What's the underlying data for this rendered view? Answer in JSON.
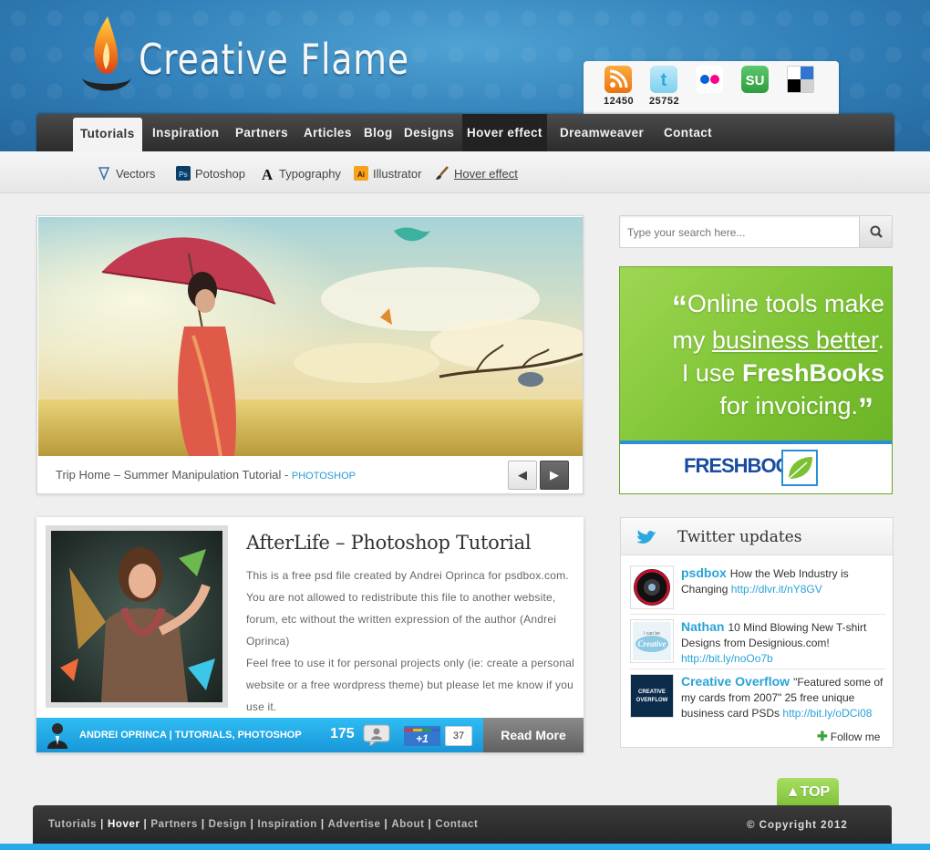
{
  "site": {
    "title": "Creative Flame"
  },
  "social": {
    "rss_count": "12450",
    "twitter_count": "25752"
  },
  "nav": {
    "items": [
      {
        "label": "Tutorials",
        "state": "active"
      },
      {
        "label": "Inspiration",
        "state": ""
      },
      {
        "label": "Partners",
        "state": ""
      },
      {
        "label": "Articles",
        "state": ""
      },
      {
        "label": "Blog",
        "state": ""
      },
      {
        "label": "Designs",
        "state": ""
      },
      {
        "label": "Hover effect",
        "state": "hover"
      },
      {
        "label": "Dreamweaver",
        "state": ""
      },
      {
        "label": "Contact",
        "state": ""
      }
    ]
  },
  "subnav": {
    "items": [
      {
        "label": "Vectors"
      },
      {
        "label": "Potoshop"
      },
      {
        "label": "Typography"
      },
      {
        "label": "Illustrator"
      },
      {
        "label": "Hover effect"
      }
    ]
  },
  "slider": {
    "caption": "Trip Home – Summer  Manipulation Tutorial - ",
    "category": "PHOTOSHOP",
    "prev": "◀",
    "next": "▶"
  },
  "post": {
    "title": "AfterLife – Photoshop Tutorial",
    "paragraph1": "This is a free psd file created by Andrei Oprinca for psdbox.com. You are not allowed to redistribute this file to another website, forum, etc without the written expression of the author (Andrei Oprinca)",
    "paragraph2": "Feel free to use it for personal projects only (ie: create a personal website or a free wordpress theme) but please let me know if you use it.",
    "meta": "ANDREI OPRINCA | TUTORIALS, PHOTOSHOP",
    "comments": "175",
    "plus_one": "+1",
    "plus_one_count": "37",
    "read_more": "Read More"
  },
  "search": {
    "placeholder": "Type your search here..."
  },
  "ad": {
    "line1": "Online tools make",
    "line2_pre": "my ",
    "line2_u": "business better",
    "line2_post": ".",
    "line3_pre": "I use ",
    "line3_b": "FreshBooks",
    "line4": "for invoicing.",
    "logo": "FRESHBOOKS"
  },
  "twitter": {
    "title": "Twitter updates",
    "tweets": [
      {
        "name": "psdbox",
        "text": "How the Web Industry is Changing ",
        "link": "http://dlvr.it/nY8GV"
      },
      {
        "name": "Nathan",
        "text": "10 Mind Blowing New T-shirt Designs from Designious.com! ",
        "link": "http://bit.ly/noOo7b"
      },
      {
        "name": "Creative Overflow",
        "text": "\"Featured some of my cards  from 2007\" 25 free unique business  card PSDs ",
        "link": "http://bit.ly/oDCi08"
      }
    ],
    "follow": "Follow me"
  },
  "top_button": "▲TOP",
  "footer": {
    "links": [
      {
        "label": "Tutorials",
        "strong": false
      },
      {
        "label": "Hover",
        "strong": true
      },
      {
        "label": "Partners",
        "strong": false
      },
      {
        "label": "Design",
        "strong": false
      },
      {
        "label": "Inspiration",
        "strong": false
      },
      {
        "label": "Advertise",
        "strong": false
      },
      {
        "label": "About",
        "strong": false
      },
      {
        "label": "Contact",
        "strong": false
      }
    ],
    "copyright": "© Copyright 2012"
  },
  "colors": {
    "header_blue": "#2f7cb6",
    "accent_blue": "#2a9bd1",
    "ad_green": "#7bc232",
    "nav_dark": "#2c2c2c"
  }
}
